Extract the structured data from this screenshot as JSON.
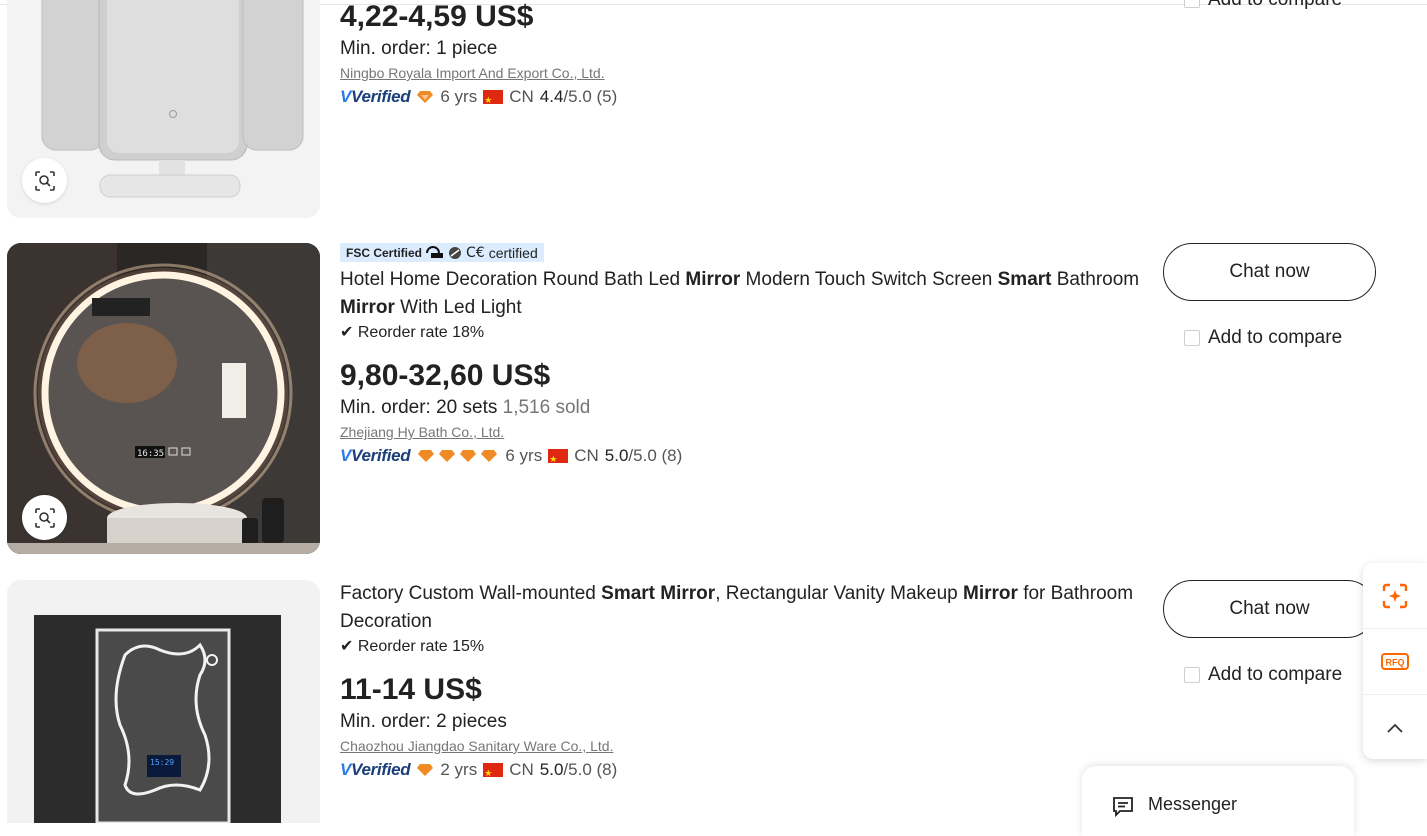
{
  "products": [
    {
      "price": "4,22-4,59 US$",
      "min_order": "Min. order: 1 piece",
      "supplier": "Ningbo Royala Import And Export Co., Ltd.",
      "verified": "Verified",
      "years": "6 yrs",
      "country": "CN",
      "rating": "4.4",
      "rating_max": "/5.0",
      "reviews": "(5)",
      "compare": "Add to compare"
    },
    {
      "badges": {
        "fsc": "FSC Certified",
        "ce": "certified"
      },
      "title_parts": [
        "Hotel Home Decoration Round Bath Led ",
        "Mirror",
        " Modern Touch Switch Screen ",
        "Smart",
        " Bathroom ",
        "Mirror",
        " With Led Light"
      ],
      "reorder": "Reorder rate 18%",
      "price": "9,80-32,60 US$",
      "min_order": "Min. order: 20 sets",
      "sold": "1,516 sold",
      "supplier": "Zhejiang Hy Bath Co., Ltd.",
      "verified": "Verified",
      "years": "6 yrs",
      "country": "CN",
      "rating": "5.0",
      "rating_max": "/5.0",
      "reviews": "(8)",
      "chat": "Chat now",
      "compare": "Add to compare",
      "device_clock": "16:35"
    },
    {
      "title_parts": [
        "Factory Custom Wall-mounted ",
        "Smart Mirror",
        ", Rectangular Vanity Makeup ",
        "Mirror",
        " for Bathroom Decoration"
      ],
      "reorder": "Reorder rate 15%",
      "price": "11-14 US$",
      "min_order": "Min. order: 2 pieces",
      "supplier": "Chaozhou Jiangdao Sanitary Ware Co., Ltd.",
      "verified": "Verified",
      "years": "2 yrs",
      "country": "CN",
      "rating": "5.0",
      "rating_max": "/5.0",
      "reviews": "(8)",
      "chat": "Chat now",
      "compare": "Add to compare",
      "device_clock": "15:29"
    }
  ],
  "floating_toolbar": {
    "rfq": "RFQ"
  },
  "messenger": {
    "label": "Messenger"
  },
  "colors": {
    "accent": "#ff6600",
    "verified_blue": "#2a7be4",
    "badge_bg": "#dcecff"
  }
}
